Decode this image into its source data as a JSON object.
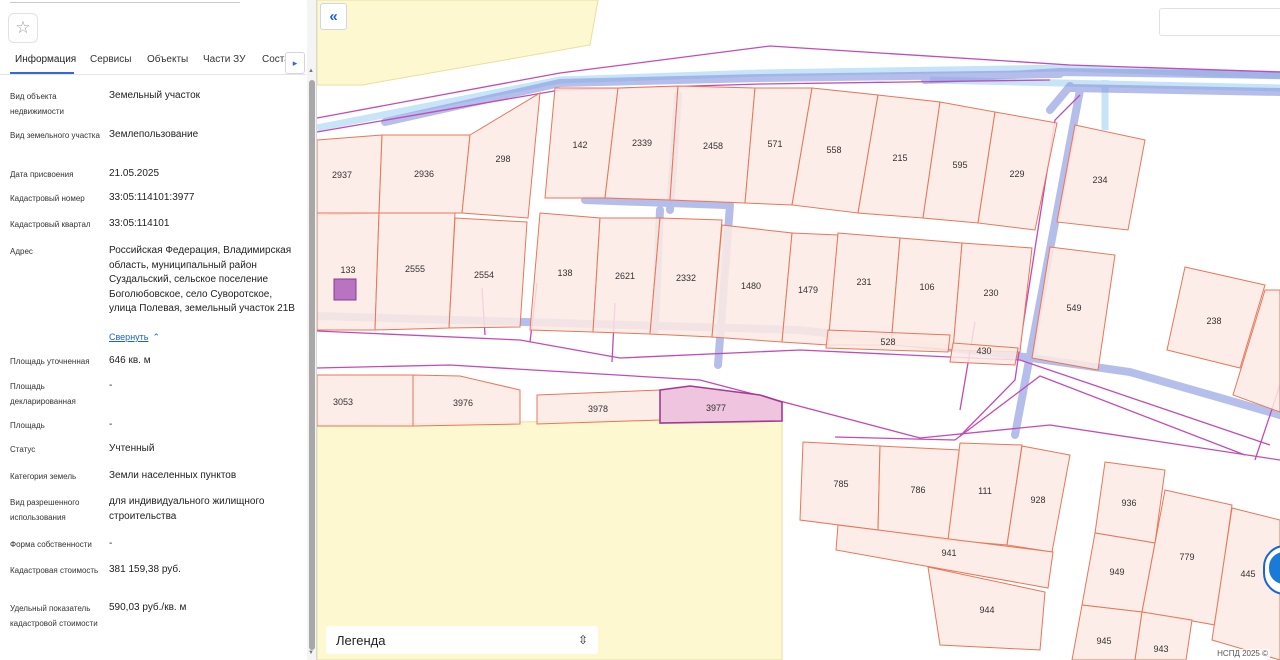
{
  "tabs": [
    {
      "label": "Информация",
      "active": true
    },
    {
      "label": "Сервисы"
    },
    {
      "label": "Объекты"
    },
    {
      "label": "Части ЗУ"
    },
    {
      "label": "Состав"
    }
  ],
  "info_rows": [
    {
      "label": "Вид объекта недвижимости",
      "value": "Земельный участок"
    },
    {
      "label": "Вид земельного участка",
      "value": "Землепользование"
    },
    {
      "label": "Дата присвоения",
      "value": "21.05.2025"
    },
    {
      "label": "Кадастровый номер",
      "value": "33:05:114101:3977"
    },
    {
      "label": "Кадастровый квартал",
      "value": "33:05:114101"
    },
    {
      "label": "Адрес",
      "value": "Российская Федерация, Владимирская область, муниципальный район Суздальский, сельское поселение Боголюбовское, село Суворотское, улица Полевая, земельный участок 21В"
    },
    {
      "label": "Площадь уточненная",
      "value": "646 кв. м"
    },
    {
      "label": "Площадь декларированная",
      "value": "-"
    },
    {
      "label": "Площадь",
      "value": "-"
    },
    {
      "label": "Статус",
      "value": "Учтенный"
    },
    {
      "label": "Категория земель",
      "value": "Земли населенных пунктов"
    },
    {
      "label": "Вид разрешенного использования",
      "value": "для индивидуального жилищного строительства"
    },
    {
      "label": "Форма собственности",
      "value": "-"
    },
    {
      "label": "Кадастровая стоимость",
      "value": "381 159,38 руб."
    },
    {
      "label": "Удельный показатель кадастровой стоимости",
      "value": "590,03 руб./кв. м"
    }
  ],
  "collapse_label": "Свернуть",
  "legend_label": "Легенда",
  "copyright": "НСПД 2025 ©",
  "colors": {
    "accent": "#2e6bd8",
    "parcel_fill": "#fdeae4",
    "parcel_stroke": "#e8765a",
    "selected_fill": "#eec4de",
    "selected_stroke": "#a23a8f",
    "zone_fill": "#fdf8d0",
    "road_line": "#c24bb8",
    "utility_line": "#8e9ce0"
  },
  "icons": {
    "favorite": "star-icon",
    "tabs_next": "chevron-right-icon",
    "collapse": "chevron-up-icon",
    "map_back": "double-chevron-left-icon",
    "legend": "up-down-chevron-icon"
  },
  "parcels": {
    "p2937": "2937",
    "p2936": "2936",
    "p298": "298",
    "p142": "142",
    "p2339": "2339",
    "p2458": "2458",
    "p571": "571",
    "p558": "558",
    "p215": "215",
    "p595": "595",
    "p229": "229",
    "p234": "234",
    "p133": "133",
    "p2555": "2555",
    "p2554": "2554",
    "p138": "138",
    "p2621": "2621",
    "p2332": "2332",
    "p1480": "1480",
    "p1479": "1479",
    "p231": "231",
    "p106": "106",
    "p230": "230",
    "p549": "549",
    "p528": "528",
    "p430": "430",
    "p238": "238",
    "p3053": "3053",
    "p3976": "3976",
    "p3978": "3978",
    "p3977": "3977",
    "p785": "785",
    "p786": "786",
    "p111": "111",
    "p928": "928",
    "p941": "941",
    "p944": "944",
    "p936": "936",
    "p949": "949",
    "p779": "779",
    "p445": "445",
    "p945": "945",
    "p943": "943"
  }
}
